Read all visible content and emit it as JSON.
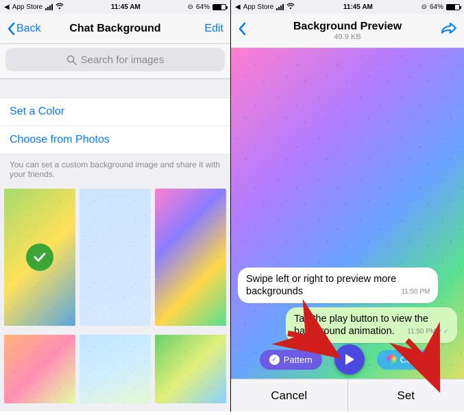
{
  "status": {
    "back_app": "App Store",
    "time": "11:45 AM",
    "battery_pct": "64%"
  },
  "left": {
    "nav_back": "Back",
    "title": "Chat Background",
    "nav_edit": "Edit",
    "search_placeholder": "Search for images",
    "set_color": "Set a Color",
    "choose_photos": "Choose from Photos",
    "help_text": "You can set a custom background image and share it with your friends."
  },
  "right": {
    "title": "Background Preview",
    "subtitle": "49.9 KB",
    "msg1": "Swipe left or right to preview more backgrounds",
    "msg1_ts": "11:50 PM",
    "msg2": "Tap the play button to view the background animation.",
    "msg2_ts": "11:50 PM",
    "pattern_label": "Pattern",
    "colors_label": "Colors",
    "cancel": "Cancel",
    "set": "Set"
  }
}
